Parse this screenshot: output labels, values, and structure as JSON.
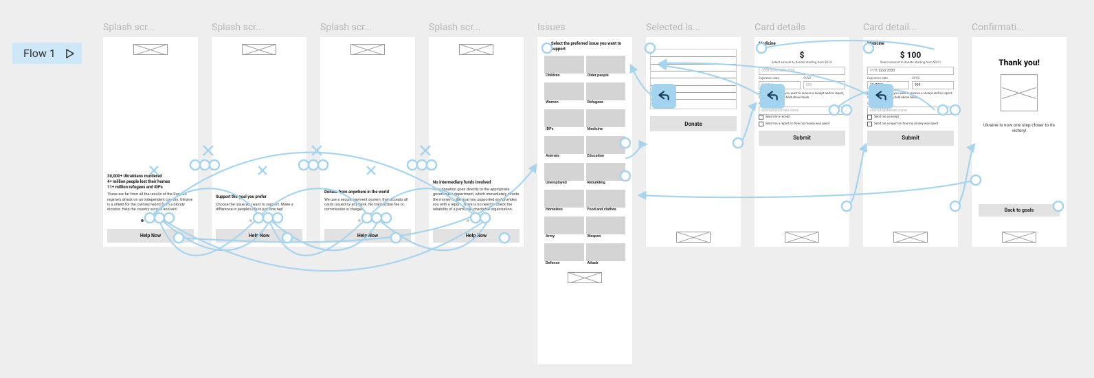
{
  "flow_label": "Flow 1",
  "frames": {
    "splash": [
      {
        "title": "Splash scr...",
        "heading": "30,000+ Ukrainians murdered\n4+ million people lost their homes\n11+ million refugees and IDPs",
        "body": "These are far from all the results of the Russian regime's attack on an independent country. Ukraine is a shield for the civilized world from a bloody dictator. Help the country survive and win!",
        "button": "Help Now",
        "active_dot": 0
      },
      {
        "title": "Splash scr...",
        "heading": "Support the goal you prefer",
        "body": "Choose the issue you want to support. Make a difference in people's life in just one tap!",
        "button": "Help Now",
        "active_dot": 1
      },
      {
        "title": "Splash scr...",
        "heading": "Donate from anywhere in the world",
        "body": "We use a secure payment system, that accepts all cards issued by any bank. No transaction fee or commission is charged.",
        "button": "Help Now",
        "active_dot": 2
      },
      {
        "title": "Splash scr...",
        "heading": "No intermediary funds involved",
        "body": "Your donation goes directly to the appropriate government department, which immediately directs the money to the goal you supported and provides you with a report. There is no need to check the reliability of a particular charitable organization.",
        "button": "Help Now",
        "active_dot": 3
      }
    ],
    "issues": {
      "title": "Issues",
      "heading": "Select the preferred issue you want to support",
      "items": [
        "Children",
        "Older people",
        "Women",
        "Refugees",
        "IDPs",
        "Medicine",
        "Animals",
        "Education",
        "Unemployed",
        "Rebuilding",
        "Homeless",
        "Food and clothes",
        "Army",
        "Weapon",
        "Defence",
        "Attack"
      ]
    },
    "selected": {
      "title": "Selected is...",
      "button": "Donate"
    },
    "card1": {
      "title": "Card details",
      "heading": "Medicine",
      "amount": "$",
      "amount_sub": "Select amount to donate starting from $0.01",
      "card_placeholder": "0000 0000 0000 0000",
      "exp_label": "Expiration date",
      "cvv_label": "CVV2",
      "exp_ph": "MM/YY",
      "cvv_ph": "000",
      "desc": "Enter your e-mail if you want to receive a receipt and/or report, otherwise leave the field above blank",
      "email_label": "E-mail:",
      "email_ph": "example@domain.name",
      "chk1": "Send me a receipt",
      "chk2": "Send me a report on how my money was spent",
      "submit": "Submit"
    },
    "card2": {
      "title": "Card detail...",
      "heading": "Medicine",
      "amount": "$ 100",
      "amount_sub": "Select amount to donate starting from $0.01",
      "card_value": "1111 2222 3333",
      "exp_label": "Expiration date",
      "cvv_label": "CVV2",
      "exp_val": "11/2028",
      "cvv_val": "999",
      "desc": "Enter your e-mail if you want to receive a receipt and/or report, otherwise leave the field above blank",
      "email_label": "E-mail:",
      "email_ph": "example@domain.name",
      "chk1": "Send me a receipt",
      "chk2": "Send me a report on how my money was spent",
      "submit": "Submit"
    },
    "confirm": {
      "title": "Confirmati...",
      "heading": "Thank you!",
      "text": "Ukraine is now one step closer to its victory!",
      "button": "Back to goals"
    }
  }
}
